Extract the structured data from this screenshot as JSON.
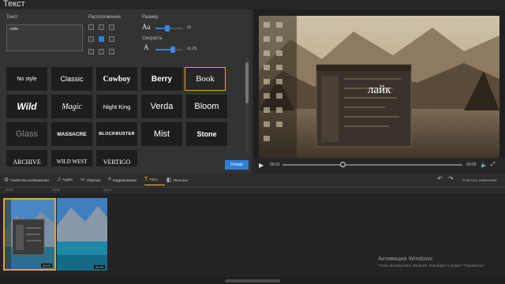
{
  "window": {
    "title": "Текст"
  },
  "settings": {
    "text_label": "Текст",
    "text_value": "лайк",
    "position_label": "Расположение",
    "size_label": "Размер",
    "size_icon_text": "Aa",
    "size_value": "x1",
    "speed_label": "Скорость",
    "speed_icon_text": "A",
    "speed_value": "x1.25",
    "ready_button": "Готово"
  },
  "styles": [
    "No style",
    "Classic",
    "Cowboy",
    "Berry",
    "Book",
    "Wild",
    "Magic",
    "Night King",
    "Verda",
    "Bloom",
    "Glass",
    "MASSACRE",
    "BLOCKBUSTER",
    "Mist",
    "Stone",
    "ARCHIVE",
    "WILD WEST",
    "VERTIGO"
  ],
  "selected_style": "Book",
  "preview": {
    "overlay_text": "лайк",
    "time_current": "00:01",
    "time_total": "00:05"
  },
  "tabs": [
    {
      "label": "Свойства изображения",
      "icon": "gear-icon"
    },
    {
      "label": "Аудио",
      "icon": "audio-icon"
    },
    {
      "label": "Обрезка",
      "icon": "crop-icon"
    },
    {
      "label": "Кадрирование",
      "icon": "frame-icon"
    },
    {
      "label": "Текст",
      "icon": "text-icon"
    },
    {
      "label": "Фильтры",
      "icon": "filter-icon"
    }
  ],
  "active_tab": "Текст",
  "clear_label": "Очистить изменения",
  "timeline": {
    "ruler_labels": [
      "00:00",
      "00:05",
      "00:10"
    ],
    "clip_duration": "00:05"
  },
  "watermark": {
    "line1": "Активация Windows",
    "line2": "Чтобы активировать Windows, перейдите в раздел \"Параметры\"."
  },
  "colors": {
    "accent": "#2f7fd9",
    "selection": "#e0a630",
    "active_tab": "#f0c040"
  }
}
